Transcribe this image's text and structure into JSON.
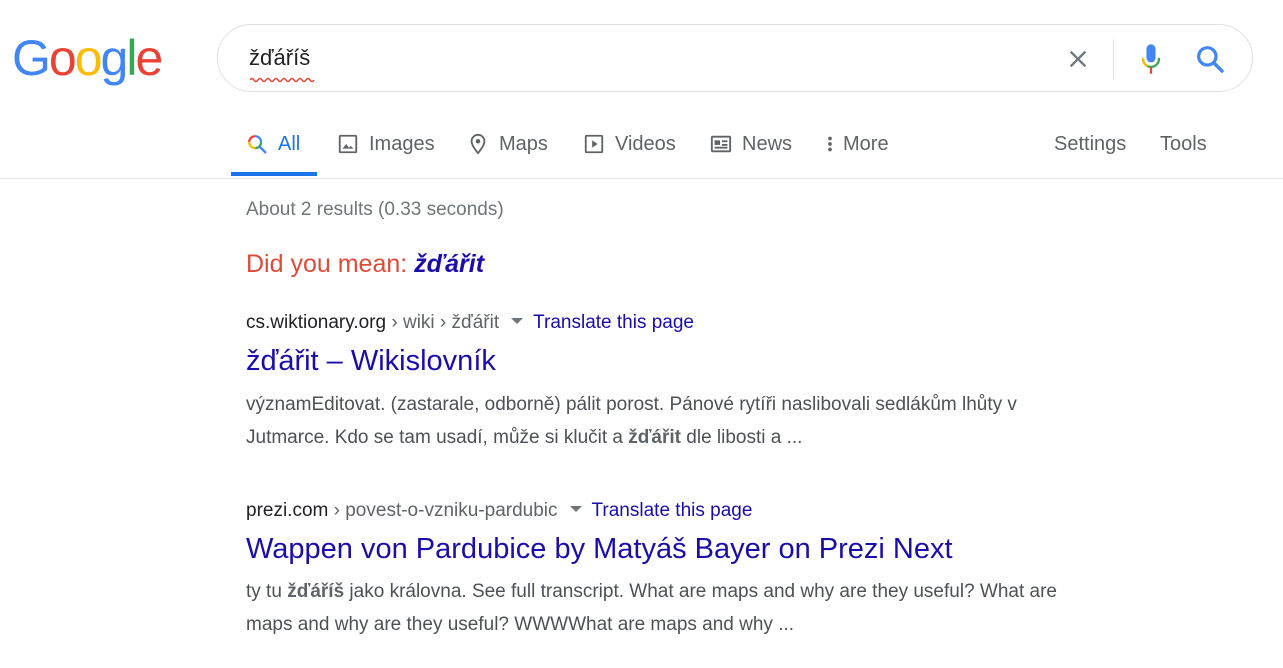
{
  "logo": {
    "letters": [
      "G",
      "o",
      "o",
      "g",
      "l",
      "e"
    ],
    "colors": [
      "#4285F4",
      "#EA4335",
      "#FBBC05",
      "#4285F4",
      "#34A853",
      "#EA4335"
    ]
  },
  "search": {
    "query": "žďáříš",
    "clear_icon": "close-icon",
    "mic_icon": "microphone-icon",
    "search_icon": "search-icon"
  },
  "tabs": [
    {
      "label": "All",
      "icon": "search-icon",
      "active": true
    },
    {
      "label": "Images",
      "icon": "image-icon"
    },
    {
      "label": "Maps",
      "icon": "map-pin-icon"
    },
    {
      "label": "Videos",
      "icon": "video-icon"
    },
    {
      "label": "News",
      "icon": "news-icon"
    },
    {
      "label": "More",
      "icon": "more-vertical-icon"
    }
  ],
  "tools": {
    "settings": "Settings",
    "tools": "Tools"
  },
  "stats": "About 2 results (0.33 seconds)",
  "did_you_mean": {
    "prefix": "Did you mean: ",
    "suggestion": "žďářit"
  },
  "results": [
    {
      "domain": "cs.wiktionary.org",
      "path": " › wiki › žďářit",
      "translate": "Translate this page",
      "title": "žďářit – Wikislovník",
      "snippet_line1": "významEditovat. (zastarale, odborně) pálit porost. Pánové rytíři naslibovali sedlákům lhůty v",
      "snippet_line2_pre": "Jutmarce. Kdo se tam usadí, může si klučit a ",
      "snippet_line2_bold": "žďářit",
      "snippet_line2_post": " dle libosti a ..."
    },
    {
      "domain": "prezi.com",
      "path": " › povest-o-vzniku-pardubic",
      "translate": "Translate this page",
      "title": "Wappen von Pardubice by Matyáš Bayer on Prezi Next",
      "snippet_line1_pre": "ty tu ",
      "snippet_line1_bold": "žďáříš",
      "snippet_line1_post": " jako královna. See full transcript. What are maps and why are they useful? What are",
      "snippet_line2": "maps and why are they useful? WWWWhat are maps and why ..."
    }
  ]
}
